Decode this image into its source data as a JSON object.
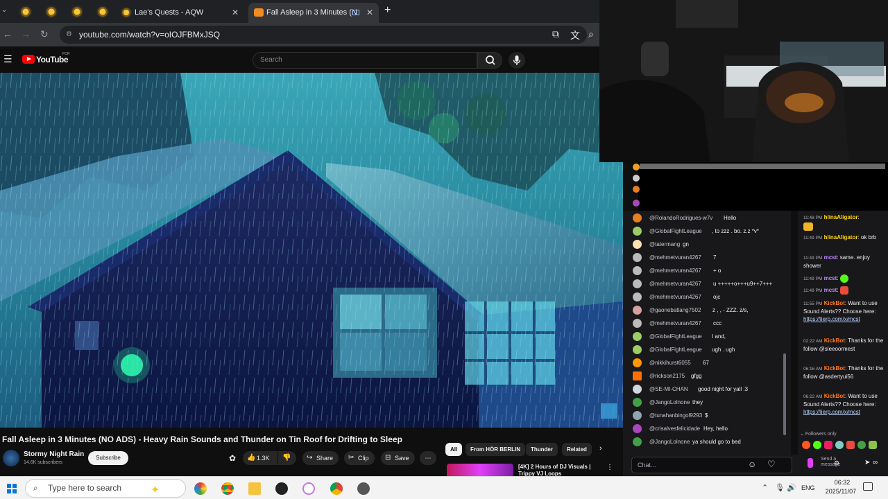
{
  "browser": {
    "tabs": [
      {
        "label": ""
      },
      {
        "label": ""
      },
      {
        "label": ""
      },
      {
        "label": ""
      },
      {
        "label": "Lae's Quests - AQW"
      },
      {
        "label": "Fall Asleep in 3 Minutes (N"
      }
    ],
    "new_tab": "+",
    "close": "✕",
    "url": "youtube.com/watch?v=oIOJFBMxJSQ"
  },
  "youtube": {
    "logo_text": "YouTube",
    "logo_badge": "FOR",
    "search_placeholder": "Search",
    "video_title": "Fall Asleep in 3 Minutes (NO ADS) - Heavy Rain Sounds and Thunder on Tin Roof for Drifting to Sleep",
    "channel_name": "Stormy Night Rain",
    "subscribers": "14.6K subscribers",
    "subscribe_label": "Subscribe",
    "like_count": "1.3K",
    "share_label": "Share",
    "clip_label": "Clip",
    "save_label": "Save",
    "chips": [
      "All",
      "From HÖR BERLIN",
      "Thunder",
      "Related"
    ],
    "rec_title": "[4K] 2 Hours of DJ Visuals | Trippy VJ Loops"
  },
  "chat_left": {
    "messages": [
      {
        "user": "@RolandoRodrigues-w7v",
        "text": "Hello",
        "color": "#e67e22"
      },
      {
        "user": "@GlobalFightLeague",
        "text": ", to zzz . bo. z.z *v*",
        "color": "#9ccc65"
      },
      {
        "user": "@tatermang",
        "text": "gn",
        "color": "#ffe0b2"
      },
      {
        "user": "@mehmetvuran4267",
        "text": "7",
        "color": "#bbbbbb"
      },
      {
        "user": "@mehmetvuran4267",
        "text": "+ o",
        "color": "#bbbbbb"
      },
      {
        "user": "@mehmetvuran4267",
        "text": "u +++++o+++u9++7+++",
        "color": "#bbbbbb"
      },
      {
        "user": "@mehmetvuran4267",
        "text": "ojc",
        "color": "#bbbbbb"
      },
      {
        "user": "@gaonebatlang7502",
        "text": "z , , - ZZZ. z/s,",
        "color": "#d7a0a0"
      },
      {
        "user": "@mehmetvuran4267",
        "text": "ccc",
        "color": "#bbbbbb"
      },
      {
        "user": "@GlobalFightLeague",
        "text": "I and,",
        "color": "#9ccc65"
      },
      {
        "user": "@GlobalFightLeague",
        "text": "ugh . ugh",
        "color": "#9ccc65"
      },
      {
        "user": "@nikkihurst6055",
        "text": "67",
        "color": "#ff9800"
      },
      {
        "user": "@rickson2175",
        "text": "gfgg",
        "color": "#ff6f00"
      },
      {
        "user": "@SE-MI-CHAN",
        "text": "good night for yall :3",
        "color": "#cfd8dc"
      },
      {
        "user": "@JangoLolnone",
        "text": "they",
        "color": "#43a047"
      },
      {
        "user": "@tunahanbingol9293",
        "text": "$",
        "color": "#90a4ae"
      },
      {
        "user": "@crisalvesfelicidade",
        "text": "Hey, hello",
        "color": "#ab47bc"
      },
      {
        "user": "@JangoLolnone",
        "text": "ya should go to bed",
        "color": "#43a047"
      }
    ],
    "input_placeholder": "Chat..."
  },
  "chat_right": {
    "messages": [
      {
        "time": "11:48 PM",
        "name": "hlinaAligator",
        "text": ":",
        "cls": ""
      },
      {
        "time": "11:49 PM",
        "name": "hlinaAligator",
        "text": ": ok brb",
        "cls": ""
      },
      {
        "time": "11:49 PM",
        "name": "mcst",
        "text": ": same. enjoy shower",
        "cls": "p"
      },
      {
        "time": "11:49 PM",
        "name": "mcst",
        "text": ":",
        "cls": "p"
      },
      {
        "time": "11:49 PM",
        "name": "mcst",
        "text": ":",
        "cls": "p"
      },
      {
        "time": "11:55 PM",
        "name": "KickBot",
        "text": ": Want to use Sound Alerts?? Choose here:",
        "link": "https://lierp.com/x/mcst",
        "cls": "o"
      },
      {
        "time": "02:22 AM",
        "name": "KickBot",
        "text": ": Thanks for the follow @sleeoormest",
        "cls": "o"
      },
      {
        "time": "06:16 AM",
        "name": "KickBot",
        "text": ": Thanks for the follow @asdertyui56",
        "cls": "o"
      },
      {
        "time": "06:22 AM",
        "name": "KickBot",
        "text": ": Want to use Sound Alerts?? Choose here:",
        "link": "https://lierp.com/x/mcst",
        "cls": "o"
      }
    ],
    "followers_only": "Followers only",
    "send_label": "Send a message"
  },
  "taskbar": {
    "search_placeholder": "Type here to search",
    "lang": "ENG",
    "time": "06:32",
    "date": "2025/11/07"
  },
  "colors": {
    "youtube_red": "#ff0000",
    "kick_green": "#53fc18",
    "twitch_bg": "#18181b"
  }
}
